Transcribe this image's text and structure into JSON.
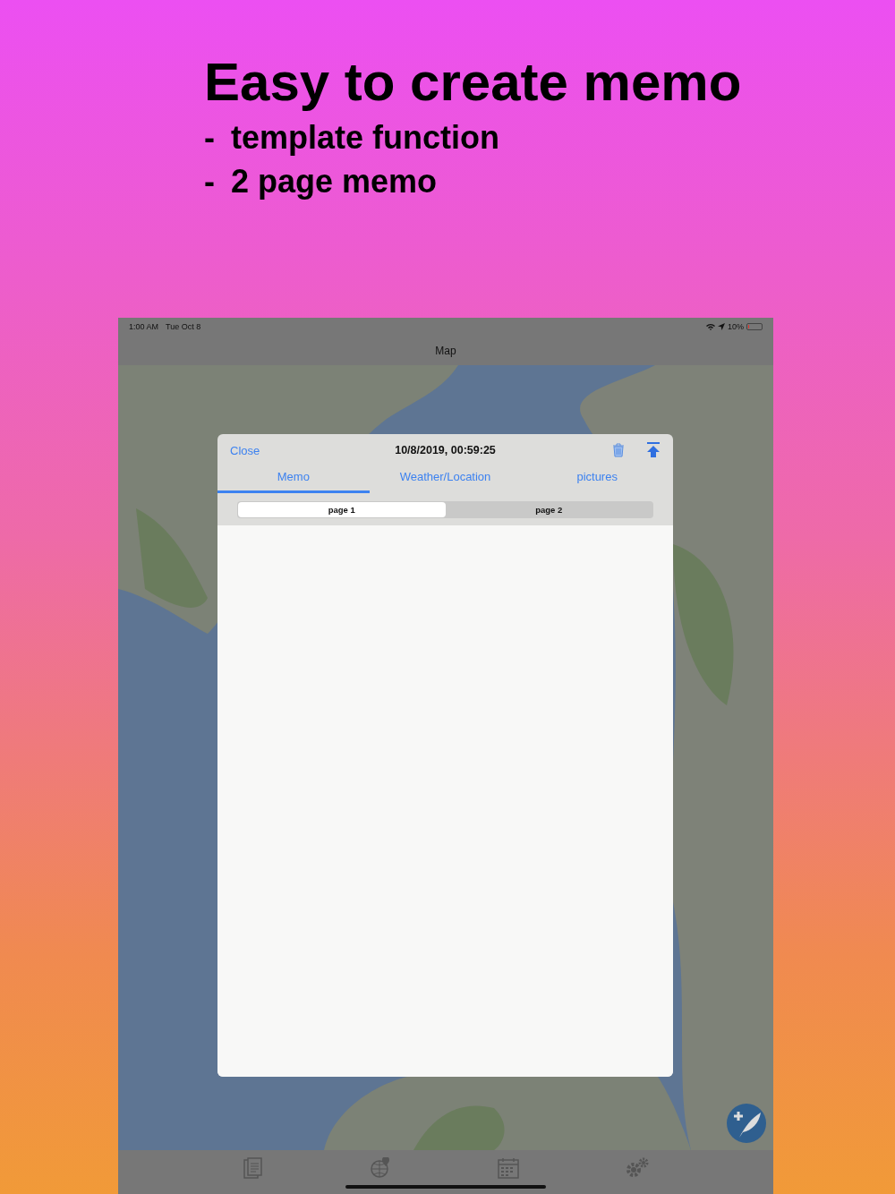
{
  "headline": "Easy to create memo",
  "bullets": [
    {
      "marker": "-",
      "text": "template function"
    },
    {
      "marker": "-",
      "text": "2 page memo"
    }
  ],
  "status_bar": {
    "time": "1:00 AM",
    "date": "Tue Oct 8",
    "battery": {
      "text": "10%",
      "level": 0.1
    }
  },
  "nav_bar": {
    "title": "Map"
  },
  "memo_sheet": {
    "close": "Close",
    "timestamp": "10/8/2019, 00:59:25",
    "tabs": [
      {
        "label": "Memo",
        "selected": true
      },
      {
        "label": "Weather/Location",
        "selected": false
      },
      {
        "label": "pictures",
        "selected": false
      }
    ],
    "pages": [
      {
        "label": "page 1",
        "selected": true
      },
      {
        "label": "page 2",
        "selected": false
      }
    ]
  }
}
